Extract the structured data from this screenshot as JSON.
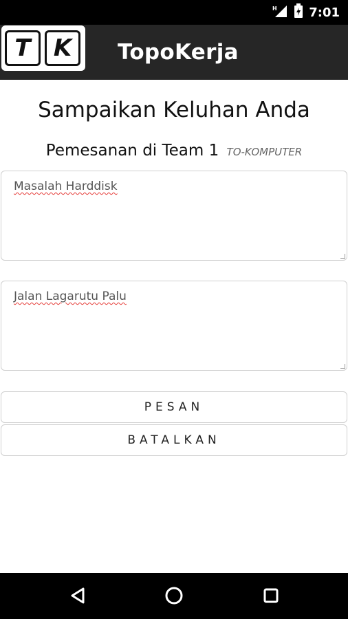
{
  "status_bar": {
    "time": "7:01",
    "icons": [
      "signal-icon",
      "battery-charging-icon"
    ]
  },
  "app_bar": {
    "logo_letters": [
      "T",
      "K"
    ],
    "title": "TopoKerja"
  },
  "form": {
    "heading": "Sampaikan Keluhan Anda",
    "subheading": "Pemesanan di Team 1",
    "subheading_tag": "TO-KOMPUTER",
    "complaint_value": "Masalah Harddisk",
    "address_value": "Jalan Lagarutu Palu",
    "submit_label": "PESAN",
    "cancel_label": "BATALKAN"
  },
  "nav_bar": {
    "icons": [
      "back-icon",
      "home-icon",
      "recents-icon"
    ]
  }
}
